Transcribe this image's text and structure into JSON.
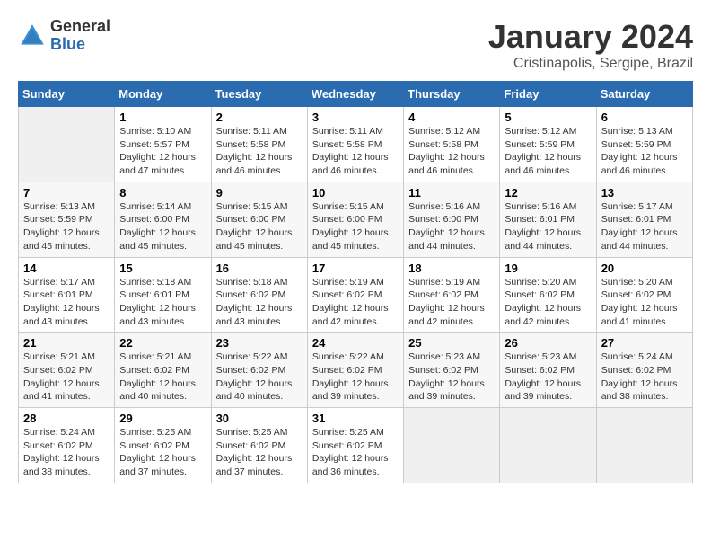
{
  "logo": {
    "general": "General",
    "blue": "Blue"
  },
  "title": "January 2024",
  "subtitle": "Cristinapolis, Sergipe, Brazil",
  "days_of_week": [
    "Sunday",
    "Monday",
    "Tuesday",
    "Wednesday",
    "Thursday",
    "Friday",
    "Saturday"
  ],
  "weeks": [
    [
      {
        "day": "",
        "sunrise": "",
        "sunset": "",
        "daylight": ""
      },
      {
        "day": "1",
        "sunrise": "Sunrise: 5:10 AM",
        "sunset": "Sunset: 5:57 PM",
        "daylight": "Daylight: 12 hours and 47 minutes."
      },
      {
        "day": "2",
        "sunrise": "Sunrise: 5:11 AM",
        "sunset": "Sunset: 5:58 PM",
        "daylight": "Daylight: 12 hours and 46 minutes."
      },
      {
        "day": "3",
        "sunrise": "Sunrise: 5:11 AM",
        "sunset": "Sunset: 5:58 PM",
        "daylight": "Daylight: 12 hours and 46 minutes."
      },
      {
        "day": "4",
        "sunrise": "Sunrise: 5:12 AM",
        "sunset": "Sunset: 5:58 PM",
        "daylight": "Daylight: 12 hours and 46 minutes."
      },
      {
        "day": "5",
        "sunrise": "Sunrise: 5:12 AM",
        "sunset": "Sunset: 5:59 PM",
        "daylight": "Daylight: 12 hours and 46 minutes."
      },
      {
        "day": "6",
        "sunrise": "Sunrise: 5:13 AM",
        "sunset": "Sunset: 5:59 PM",
        "daylight": "Daylight: 12 hours and 46 minutes."
      }
    ],
    [
      {
        "day": "7",
        "sunrise": "Sunrise: 5:13 AM",
        "sunset": "Sunset: 5:59 PM",
        "daylight": "Daylight: 12 hours and 45 minutes."
      },
      {
        "day": "8",
        "sunrise": "Sunrise: 5:14 AM",
        "sunset": "Sunset: 6:00 PM",
        "daylight": "Daylight: 12 hours and 45 minutes."
      },
      {
        "day": "9",
        "sunrise": "Sunrise: 5:15 AM",
        "sunset": "Sunset: 6:00 PM",
        "daylight": "Daylight: 12 hours and 45 minutes."
      },
      {
        "day": "10",
        "sunrise": "Sunrise: 5:15 AM",
        "sunset": "Sunset: 6:00 PM",
        "daylight": "Daylight: 12 hours and 45 minutes."
      },
      {
        "day": "11",
        "sunrise": "Sunrise: 5:16 AM",
        "sunset": "Sunset: 6:00 PM",
        "daylight": "Daylight: 12 hours and 44 minutes."
      },
      {
        "day": "12",
        "sunrise": "Sunrise: 5:16 AM",
        "sunset": "Sunset: 6:01 PM",
        "daylight": "Daylight: 12 hours and 44 minutes."
      },
      {
        "day": "13",
        "sunrise": "Sunrise: 5:17 AM",
        "sunset": "Sunset: 6:01 PM",
        "daylight": "Daylight: 12 hours and 44 minutes."
      }
    ],
    [
      {
        "day": "14",
        "sunrise": "Sunrise: 5:17 AM",
        "sunset": "Sunset: 6:01 PM",
        "daylight": "Daylight: 12 hours and 43 minutes."
      },
      {
        "day": "15",
        "sunrise": "Sunrise: 5:18 AM",
        "sunset": "Sunset: 6:01 PM",
        "daylight": "Daylight: 12 hours and 43 minutes."
      },
      {
        "day": "16",
        "sunrise": "Sunrise: 5:18 AM",
        "sunset": "Sunset: 6:02 PM",
        "daylight": "Daylight: 12 hours and 43 minutes."
      },
      {
        "day": "17",
        "sunrise": "Sunrise: 5:19 AM",
        "sunset": "Sunset: 6:02 PM",
        "daylight": "Daylight: 12 hours and 42 minutes."
      },
      {
        "day": "18",
        "sunrise": "Sunrise: 5:19 AM",
        "sunset": "Sunset: 6:02 PM",
        "daylight": "Daylight: 12 hours and 42 minutes."
      },
      {
        "day": "19",
        "sunrise": "Sunrise: 5:20 AM",
        "sunset": "Sunset: 6:02 PM",
        "daylight": "Daylight: 12 hours and 42 minutes."
      },
      {
        "day": "20",
        "sunrise": "Sunrise: 5:20 AM",
        "sunset": "Sunset: 6:02 PM",
        "daylight": "Daylight: 12 hours and 41 minutes."
      }
    ],
    [
      {
        "day": "21",
        "sunrise": "Sunrise: 5:21 AM",
        "sunset": "Sunset: 6:02 PM",
        "daylight": "Daylight: 12 hours and 41 minutes."
      },
      {
        "day": "22",
        "sunrise": "Sunrise: 5:21 AM",
        "sunset": "Sunset: 6:02 PM",
        "daylight": "Daylight: 12 hours and 40 minutes."
      },
      {
        "day": "23",
        "sunrise": "Sunrise: 5:22 AM",
        "sunset": "Sunset: 6:02 PM",
        "daylight": "Daylight: 12 hours and 40 minutes."
      },
      {
        "day": "24",
        "sunrise": "Sunrise: 5:22 AM",
        "sunset": "Sunset: 6:02 PM",
        "daylight": "Daylight: 12 hours and 39 minutes."
      },
      {
        "day": "25",
        "sunrise": "Sunrise: 5:23 AM",
        "sunset": "Sunset: 6:02 PM",
        "daylight": "Daylight: 12 hours and 39 minutes."
      },
      {
        "day": "26",
        "sunrise": "Sunrise: 5:23 AM",
        "sunset": "Sunset: 6:02 PM",
        "daylight": "Daylight: 12 hours and 39 minutes."
      },
      {
        "day": "27",
        "sunrise": "Sunrise: 5:24 AM",
        "sunset": "Sunset: 6:02 PM",
        "daylight": "Daylight: 12 hours and 38 minutes."
      }
    ],
    [
      {
        "day": "28",
        "sunrise": "Sunrise: 5:24 AM",
        "sunset": "Sunset: 6:02 PM",
        "daylight": "Daylight: 12 hours and 38 minutes."
      },
      {
        "day": "29",
        "sunrise": "Sunrise: 5:25 AM",
        "sunset": "Sunset: 6:02 PM",
        "daylight": "Daylight: 12 hours and 37 minutes."
      },
      {
        "day": "30",
        "sunrise": "Sunrise: 5:25 AM",
        "sunset": "Sunset: 6:02 PM",
        "daylight": "Daylight: 12 hours and 37 minutes."
      },
      {
        "day": "31",
        "sunrise": "Sunrise: 5:25 AM",
        "sunset": "Sunset: 6:02 PM",
        "daylight": "Daylight: 12 hours and 36 minutes."
      },
      {
        "day": "",
        "sunrise": "",
        "sunset": "",
        "daylight": ""
      },
      {
        "day": "",
        "sunrise": "",
        "sunset": "",
        "daylight": ""
      },
      {
        "day": "",
        "sunrise": "",
        "sunset": "",
        "daylight": ""
      }
    ]
  ]
}
